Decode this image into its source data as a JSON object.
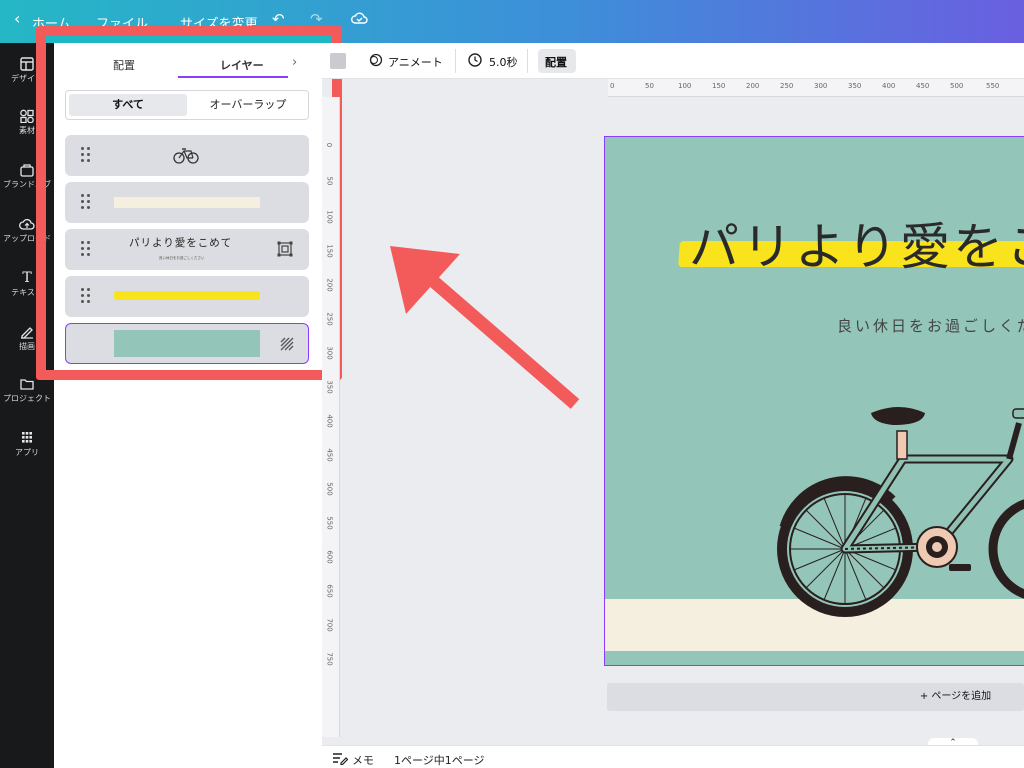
{
  "topbar": {
    "home_label": "ホーム",
    "file_label": "ファイル",
    "resize_label": "サイズを変更"
  },
  "rail": {
    "items": [
      {
        "label": "デザイン",
        "icon": "template-icon"
      },
      {
        "label": "素材",
        "icon": "elements-icon"
      },
      {
        "label": "ブランドハブ",
        "icon": "brand-icon"
      },
      {
        "label": "アップロード",
        "icon": "upload-icon"
      },
      {
        "label": "テキスト",
        "icon": "text-icon"
      },
      {
        "label": "描画",
        "icon": "draw-icon"
      },
      {
        "label": "プロジェクト",
        "icon": "folder-icon"
      },
      {
        "label": "アプリ",
        "icon": "apps-icon"
      }
    ]
  },
  "panel": {
    "tab_arrange": "配置",
    "tab_layers": "レイヤー",
    "filter_all": "すべて",
    "filter_overlap": "オーバーラップ",
    "layer_text_title": "パリより愛をこめて",
    "layer_text_sub": "良い休日をお過ごしください"
  },
  "toolbar": {
    "animate_label": "アニメート",
    "duration_label": "5.0秒",
    "position_label": "配置"
  },
  "rulers": {
    "h": [
      "0",
      "50",
      "100",
      "150",
      "200",
      "250",
      "300",
      "350",
      "400",
      "450",
      "500",
      "550"
    ],
    "v": [
      "0",
      "50",
      "100",
      "150",
      "200",
      "250",
      "300",
      "350",
      "400",
      "450",
      "500",
      "550",
      "600",
      "650",
      "700",
      "750"
    ]
  },
  "canvas": {
    "title": "パリより愛をこめて",
    "subtitle": "良い休日をお過ごしください",
    "add_page": "+ ページを追加"
  },
  "bottombar": {
    "notes_label": "メモ",
    "page_count": "1ページ中1ページ"
  },
  "colors": {
    "accent": "#8b3dff",
    "annotation": "#f35b5b",
    "canvas_bg": "#93c5b8",
    "highlight": "#f8e31c"
  }
}
